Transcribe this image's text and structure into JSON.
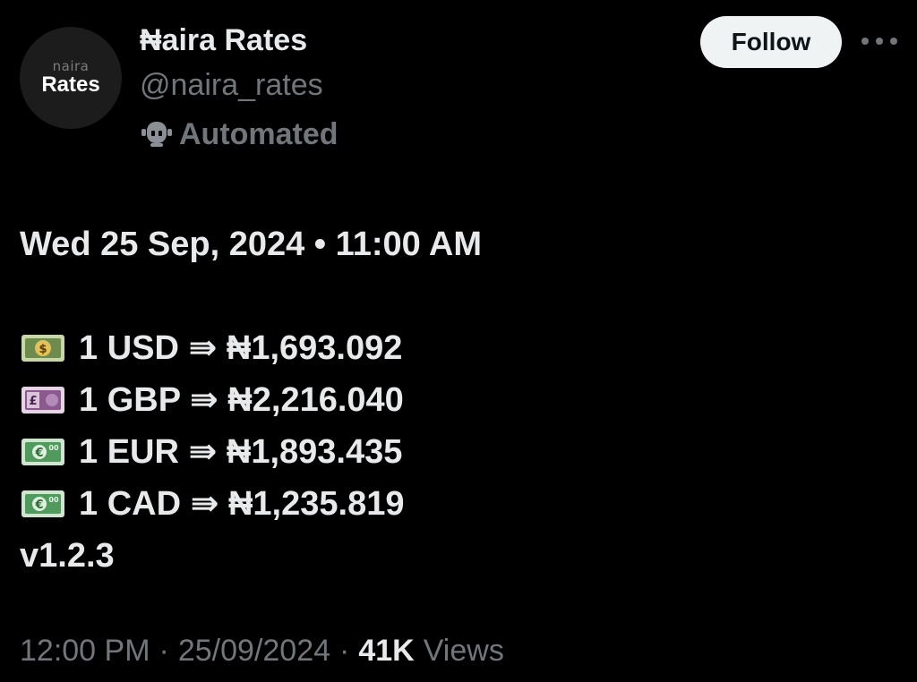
{
  "profile": {
    "avatar_small_text": "naira",
    "avatar_main_text": "Rates",
    "display_name": "₦aira Rates",
    "handle": "@naira_rates",
    "automated_label": "Automated"
  },
  "actions": {
    "follow_label": "Follow",
    "more_icon": "more-horizontal-icon"
  },
  "tweet": {
    "datetime_line": "Wed 25 Sep, 2024 • 11:00 AM",
    "rates": [
      {
        "icon": "dollar-banknote-icon",
        "text": "1 USD ⇛ ₦1,693.092",
        "accent": "#6c8b4c"
      },
      {
        "icon": "pound-banknote-icon",
        "text": "1 GBP ⇛ ₦2,216.040",
        "accent": "#8a5a8f"
      },
      {
        "icon": "euro-banknote-icon",
        "text": "1 EUR ⇛ ₦1,893.435",
        "accent": "#4f9a5c"
      },
      {
        "icon": "euro-banknote-icon",
        "text": "1 CAD ⇛ ₦1,235.819",
        "accent": "#4f9a5c"
      }
    ],
    "version": "v1.2.3"
  },
  "footer": {
    "time": "12:00 PM",
    "separator": "·",
    "date": "25/09/2024",
    "views_count": "41K",
    "views_label": "Views"
  },
  "colors": {
    "background": "#000000",
    "primary_text": "#e7e9ea",
    "secondary_text": "#71767b",
    "follow_bg": "#eff3f4"
  }
}
